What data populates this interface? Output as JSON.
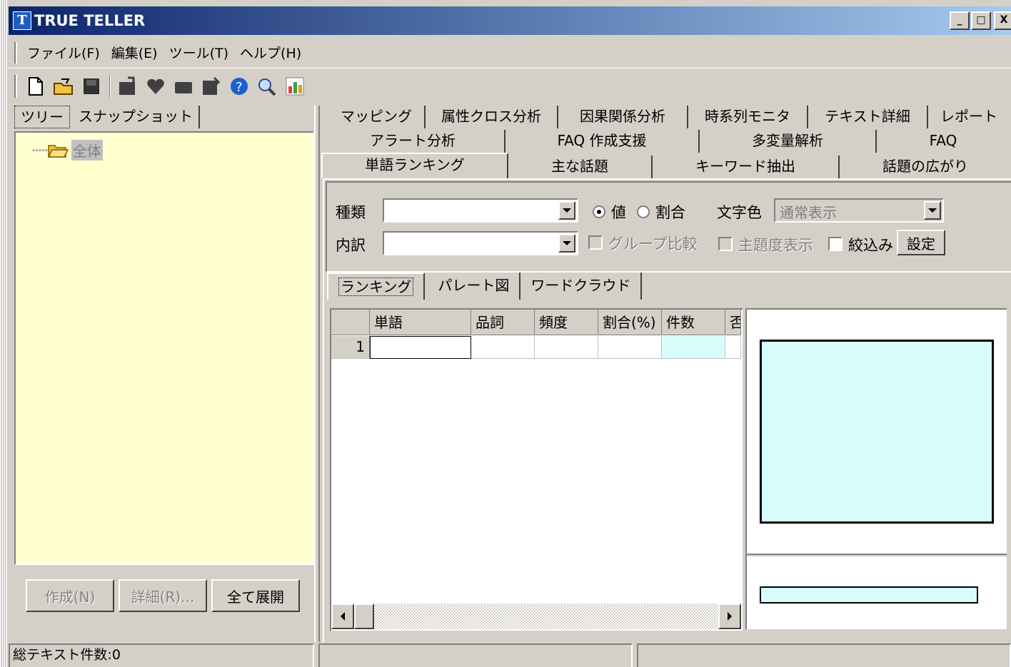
{
  "window": {
    "title": "TRUE TELLER",
    "icon_letter": "T",
    "min": "_",
    "max": "□",
    "close": "X"
  },
  "menu": [
    "ファイル(F)",
    "編集(E)",
    "ツール(T)",
    "ヘルプ(H)"
  ],
  "toolbar": [
    "new-icon",
    "open-icon",
    "save-icon",
    "db-icon",
    "heart-icon",
    "folder-icon",
    "edit-icon",
    "help-icon",
    "search-icon",
    "chart-icon"
  ],
  "left_tabs": [
    "ツリー",
    "スナップショット"
  ],
  "tree": {
    "root": "全体"
  },
  "left_buttons": {
    "create": "作成(N)",
    "detail": "詳細(R)...",
    "expand": "全て展開"
  },
  "tabs": {
    "row1": [
      "マッピング",
      "属性クロス分析",
      "因果関係分析",
      "時系列モニタ",
      "テキスト詳細",
      "レポート"
    ],
    "row2": [
      "アラート分析",
      "FAQ 作成支援",
      "多変量解析",
      "FAQ"
    ],
    "row3": [
      "単語ランキング",
      "主な話題",
      "キーワード抽出",
      "話題の広がり"
    ]
  },
  "filters": {
    "kind_label": "種類",
    "breakdown_label": "内訳",
    "value_label": "値",
    "ratio_label": "割合",
    "text_color_label": "文字色",
    "text_color_value": "通常表示",
    "group_compare": "グループ比較",
    "topic_display": "主題度表示",
    "narrow": "絞込み",
    "settings": "設定"
  },
  "sub_tabs": [
    "ランキング",
    "パレート図",
    "ワードクラウド"
  ],
  "grid": {
    "columns": [
      "単語",
      "品詞",
      "頻度",
      "割合(%)",
      "件数",
      "否"
    ],
    "rows": [
      "1"
    ]
  },
  "status": {
    "text_count": "総テキスト件数:0"
  }
}
